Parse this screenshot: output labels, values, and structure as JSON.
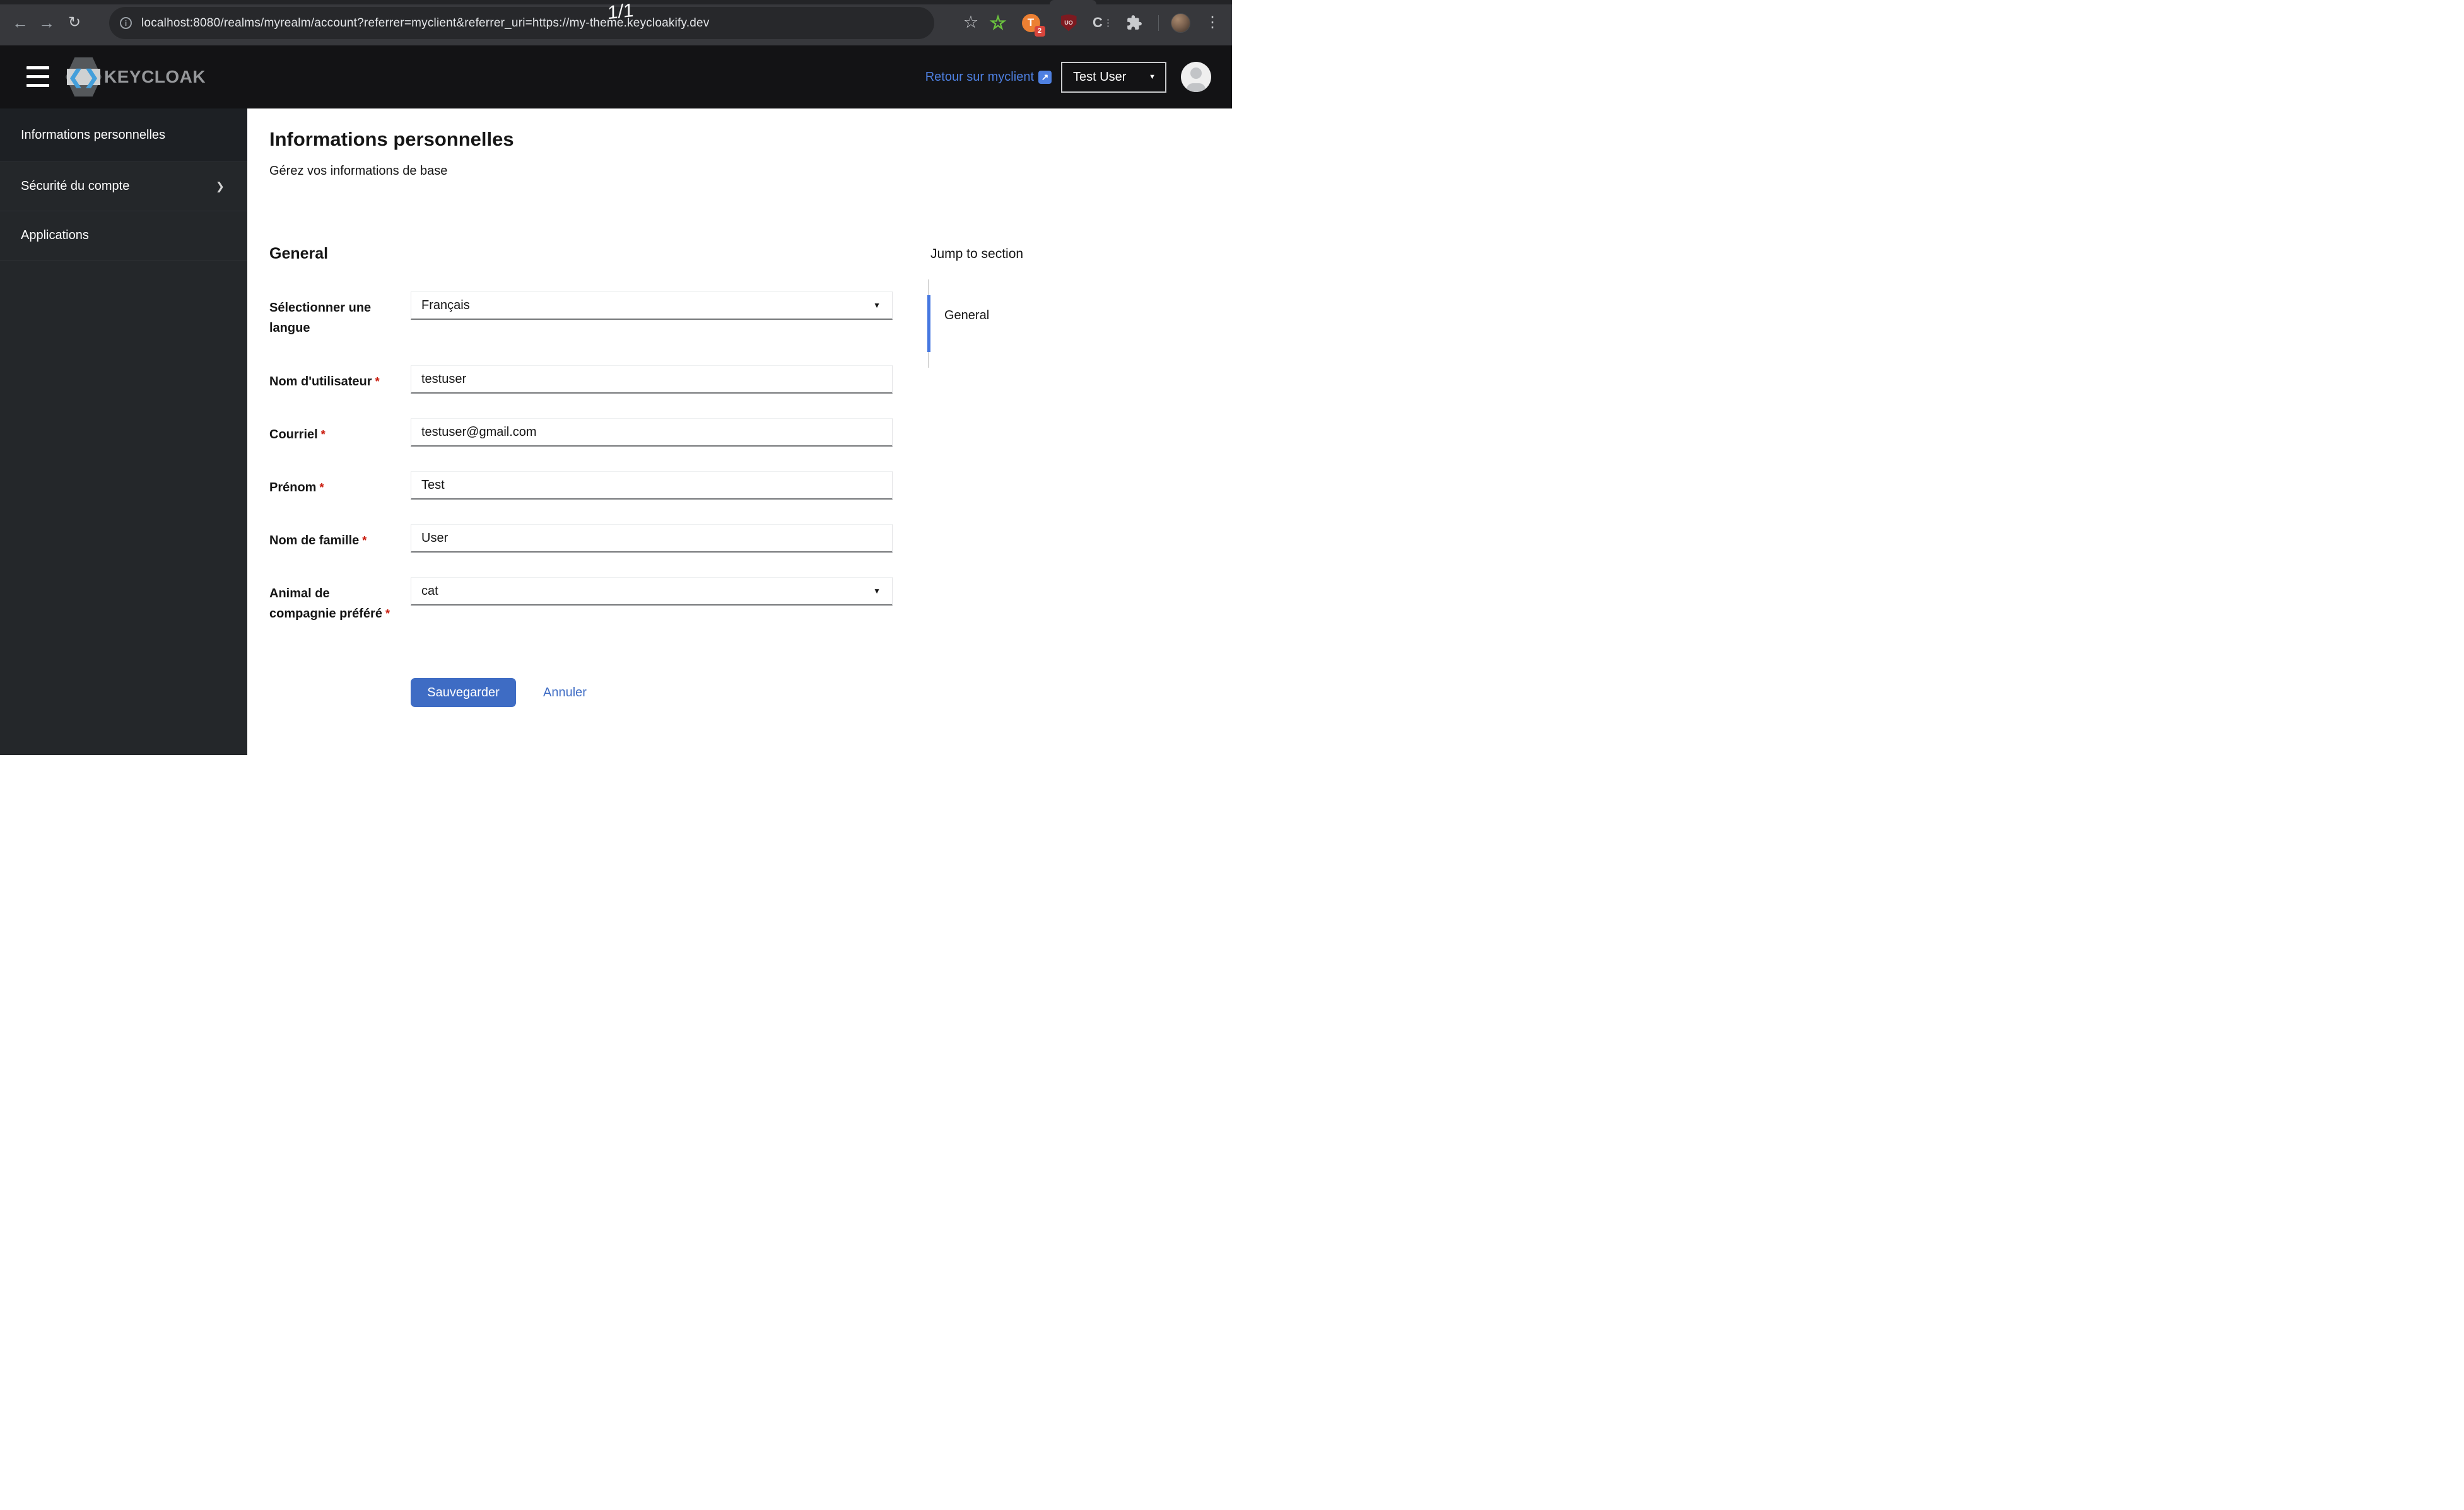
{
  "browser": {
    "url": "localhost:8080/realms/myrealm/account?referrer=myclient&referrer_uri=https://my-theme.keycloakify.dev",
    "annotation": "1/1",
    "info_glyph": "i",
    "extensions": {
      "tampermonkey_glyph": "T",
      "tampermonkey_badge": "2",
      "ublock_glyph": "UO",
      "c_glyph": "C"
    }
  },
  "app_header": {
    "logo_text": "KEYCLOAK",
    "back_link_label": "Retour sur myclient",
    "user_menu_label": "Test User"
  },
  "sidebar": {
    "items": [
      {
        "label": "Informations personnelles",
        "active": true
      },
      {
        "label": "Sécurité du compte",
        "expandable": true
      },
      {
        "label": "Applications"
      }
    ]
  },
  "main": {
    "title": "Informations personnelles",
    "subtitle": "Gérez vos informations de base",
    "section": "General",
    "required_marker": "*",
    "form": {
      "fields": [
        {
          "label": "Sélectionner une langue",
          "type": "select",
          "value": "Français",
          "required": false
        },
        {
          "label": "Nom d'utilisateur",
          "type": "text",
          "value": "testuser",
          "required": true
        },
        {
          "label": "Courriel",
          "type": "text",
          "value": "testuser@gmail.com",
          "required": true
        },
        {
          "label": "Prénom",
          "type": "text",
          "value": "Test",
          "required": true
        },
        {
          "label": "Nom de famille",
          "type": "text",
          "value": "User",
          "required": true
        },
        {
          "label": "Animal de compagnie préféré",
          "type": "select",
          "value": "cat",
          "required": true
        }
      ],
      "save_label": "Sauvegarder",
      "cancel_label": "Annuler"
    },
    "jump_nav": {
      "heading": "Jump to section",
      "items": [
        {
          "label": "General",
          "active": true
        }
      ]
    }
  },
  "colors": {
    "accent_blue": "#3e6cc4",
    "link_blue": "#4e80e1",
    "danger_red": "#c9190b",
    "header_bg": "#131315",
    "sidebar_bg": "#24272a"
  }
}
